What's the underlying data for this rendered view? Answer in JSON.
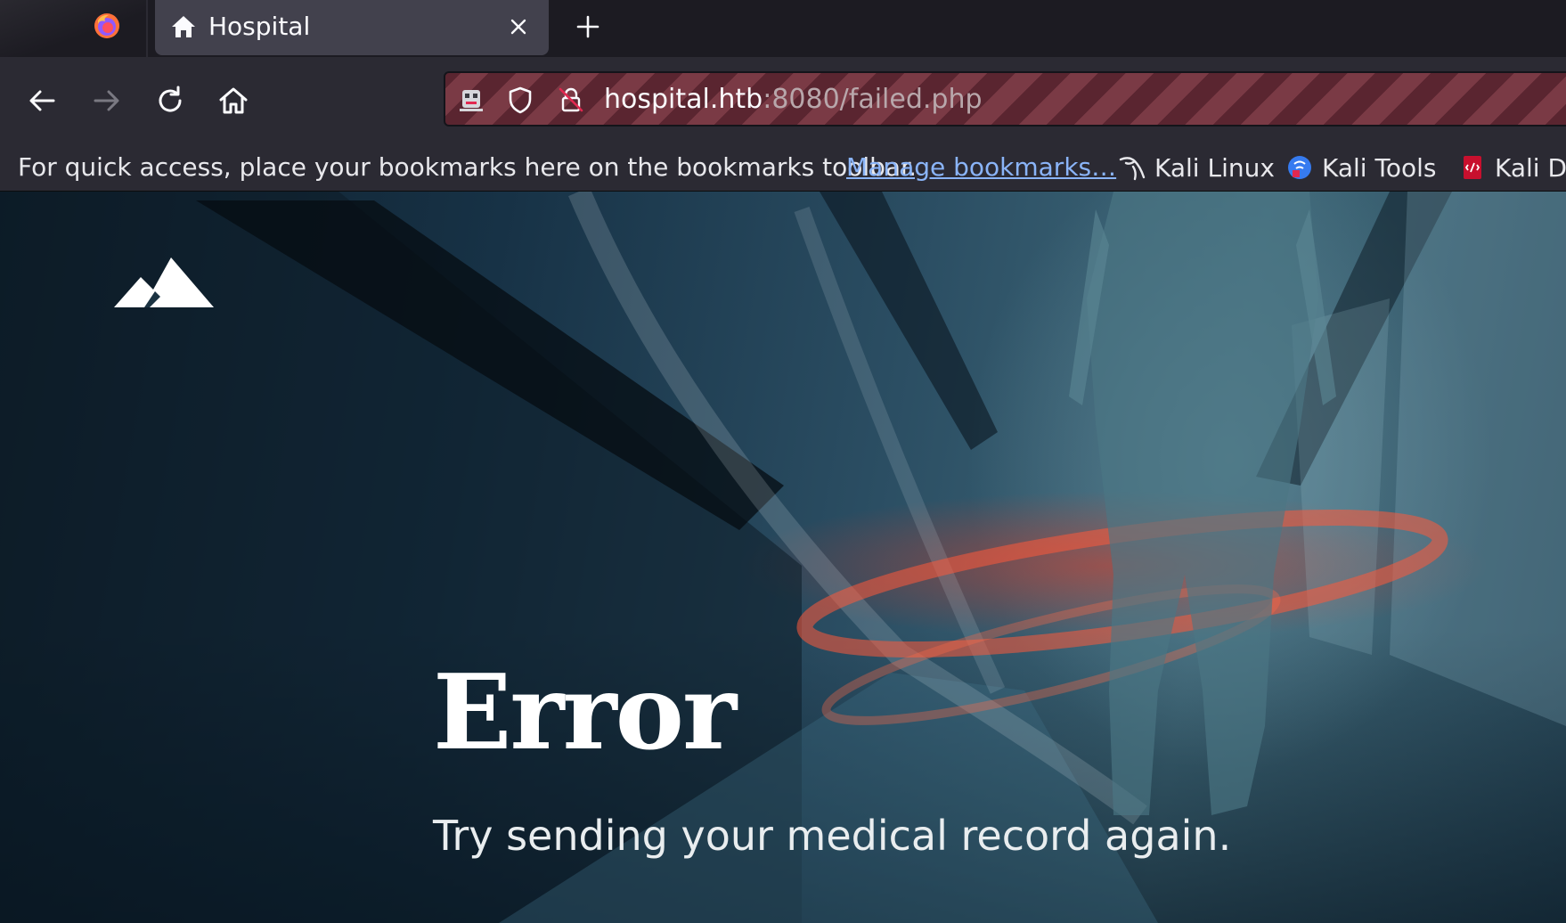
{
  "browser": {
    "tab": {
      "title": "Hospital",
      "icon": "home-icon"
    },
    "address_bar": {
      "host": "hospital.htb",
      "rest": ":8080/failed.php"
    },
    "bookmarks_bar": {
      "message": "For quick access, place your bookmarks here on the bookmarks toolbar.",
      "manage_link": "Manage bookmarks…",
      "items": [
        {
          "label": "Kali Linux",
          "icon": "kali-dragon-icon"
        },
        {
          "label": "Kali Tools",
          "icon": "kali-tools-icon"
        },
        {
          "label": "Kali Do",
          "icon": "kali-docs-icon"
        }
      ]
    }
  },
  "page": {
    "logo": "mountain-logo-icon",
    "title": "Error",
    "subtitle": "Try sending your medical record again."
  },
  "colors": {
    "tab_active": "#42414d",
    "toolbar": "#2b2a33",
    "urlbar_stripe_dark": "#5a2530",
    "urlbar_stripe_light": "#7a3a45",
    "link": "#8ab4f8"
  }
}
